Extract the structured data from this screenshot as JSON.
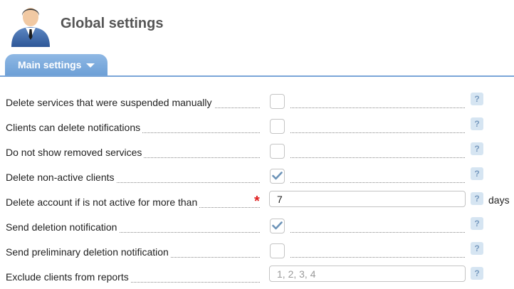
{
  "header": {
    "title": "Global settings",
    "avatar_icon": "user-avatar-icon"
  },
  "tabs": [
    {
      "label": "Main settings",
      "active": true
    }
  ],
  "colors": {
    "tab": "#6c9fd6",
    "required": "#e02020",
    "check": "#6d94b8",
    "help_bg": "#d6e5f2"
  },
  "help_symbol": "?",
  "settings": [
    {
      "label": "Delete services that were suspended manually",
      "type": "checkbox",
      "checked": false
    },
    {
      "label": "Clients can delete notifications",
      "type": "checkbox",
      "checked": false
    },
    {
      "label": "Do not show removed services",
      "type": "checkbox",
      "checked": false
    },
    {
      "label": "Delete non-active clients",
      "type": "checkbox",
      "checked": true
    },
    {
      "label": "Delete account if is not active for more than",
      "type": "number",
      "required": true,
      "required_mark": "*",
      "value": "7",
      "unit": "days"
    },
    {
      "label": "Send deletion notification",
      "type": "checkbox",
      "checked": true
    },
    {
      "label": "Send preliminary deletion notification",
      "type": "checkbox",
      "checked": false
    },
    {
      "label": "Exclude clients from reports",
      "type": "text",
      "value": "",
      "placeholder": "1, 2, 3, 4"
    }
  ]
}
